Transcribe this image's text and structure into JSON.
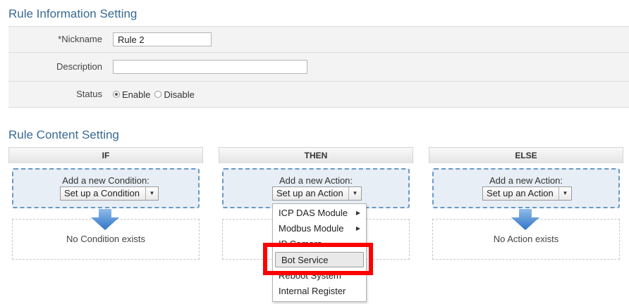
{
  "rule_info": {
    "title": "Rule Information Setting",
    "nickname_label": "*Nickname",
    "nickname_value": "Rule 2",
    "description_label": "Description",
    "description_value": "",
    "status_label": "Status",
    "status_options": [
      "Enable",
      "Disable"
    ],
    "status_selected": "Enable"
  },
  "rule_content": {
    "title": "Rule Content Setting",
    "columns": [
      {
        "header": "IF",
        "add_text": "Add a new Condition:",
        "select_value": "Set up a Condition",
        "empty_text": "No Condition exists"
      },
      {
        "header": "THEN",
        "add_text": "Add a new Action:",
        "select_value": "Set up an Action",
        "empty_text": ""
      },
      {
        "header": "ELSE",
        "add_text": "Add a new Action:",
        "select_value": "Set up an Action",
        "empty_text": "No Action exists"
      }
    ]
  },
  "dropdown": {
    "items": [
      "ICP DAS Module",
      "Modbus Module",
      "IP Camera",
      "Bot Service",
      "Reboot System",
      "Internal Register"
    ],
    "highlighted": "Bot Service"
  },
  "colors": {
    "title_blue": "#3a6a93",
    "dashed_border": "#6a98c6",
    "highlight_red": "#ff0000",
    "arrow_blue": "#4a8ad2"
  },
  "icons": {
    "select_caret": "caret-down-icon",
    "submenu": "caret-right-icon",
    "flow": "down-arrow-icon"
  }
}
